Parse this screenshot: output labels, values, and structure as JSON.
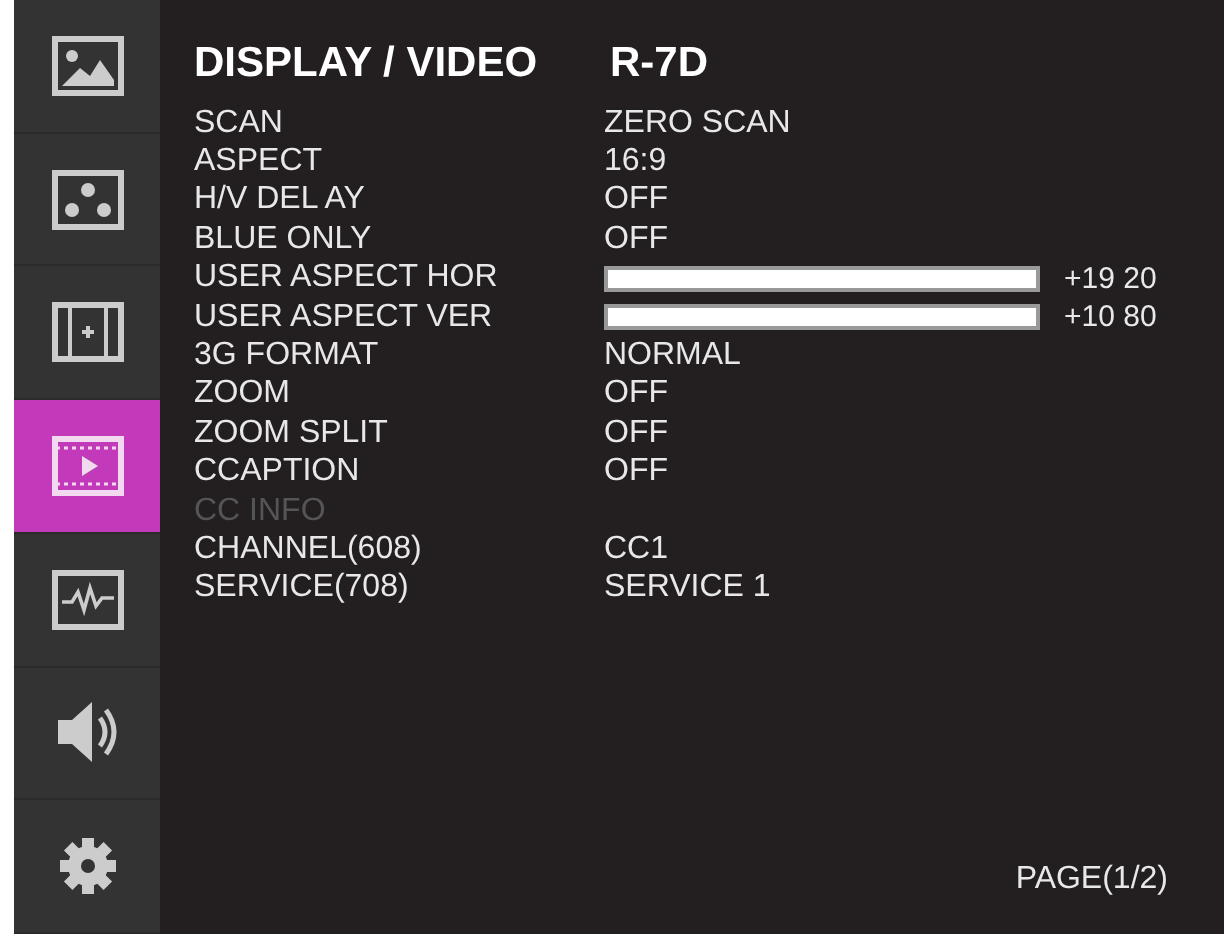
{
  "sidebar": {
    "items": [
      {
        "kind": "picture",
        "selected": false
      },
      {
        "kind": "dots",
        "selected": false
      },
      {
        "kind": "frame",
        "selected": false
      },
      {
        "kind": "video",
        "selected": true
      },
      {
        "kind": "waveform",
        "selected": false
      },
      {
        "kind": "speaker",
        "selected": false
      },
      {
        "kind": "gear",
        "selected": false
      }
    ]
  },
  "menu": {
    "title": "DISPLAY / VIDEO",
    "model": "R-7D",
    "rows": [
      {
        "kind": "text",
        "label": "SCAN",
        "value": "ZERO SCAN",
        "disabled": false
      },
      {
        "kind": "text",
        "label": "ASPECT",
        "value": "16:9",
        "disabled": false
      },
      {
        "kind": "text",
        "label": "H/V DEL AY",
        "value": "OFF",
        "disabled": false
      },
      {
        "kind": "text",
        "label": "BLUE ONLY",
        "value": "OFF",
        "disabled": false
      },
      {
        "kind": "slider",
        "label": "USER ASPECT HOR",
        "level": 1,
        "reading": "+19 20",
        "disabled": false
      },
      {
        "kind": "slider",
        "label": "USER ASPECT VER",
        "level": 1,
        "reading": "+10 80",
        "disabled": false
      },
      {
        "kind": "text",
        "label": "3G FORMAT",
        "value": "NORMAL",
        "disabled": false
      },
      {
        "kind": "text",
        "label": "ZOOM",
        "value": "OFF",
        "disabled": false
      },
      {
        "kind": "text",
        "label": "ZOOM SPLIT",
        "value": "OFF",
        "disabled": false
      },
      {
        "kind": "text",
        "label": "CCAPTION",
        "value": "OFF",
        "disabled": false
      },
      {
        "kind": "text",
        "label": "CC INFO",
        "disabled": true
      },
      {
        "kind": "text",
        "label": "CHANNEL(608)",
        "value": "CC1",
        "disabled": false
      },
      {
        "kind": "text",
        "label": "SERVICE(708)",
        "value": "SERVICE 1",
        "disabled": false
      }
    ],
    "page": "PAGE(1/2)"
  }
}
